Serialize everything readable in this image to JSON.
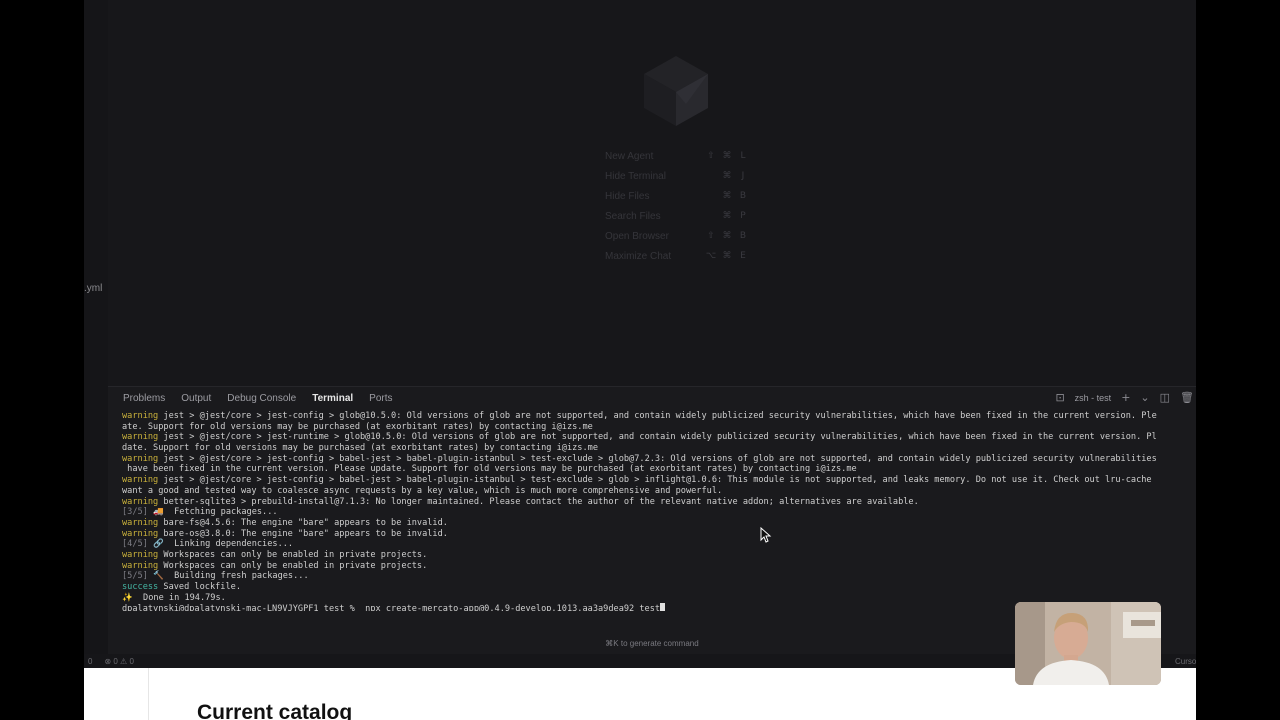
{
  "editor": {
    "file_snippet": ".yml",
    "shortcuts": [
      {
        "label": "New Agent",
        "keys": [
          "⇧",
          "⌘",
          "L"
        ]
      },
      {
        "label": "Hide Terminal",
        "keys": [
          "⌘",
          "J"
        ]
      },
      {
        "label": "Hide Files",
        "keys": [
          "⌘",
          "B"
        ]
      },
      {
        "label": "Search Files",
        "keys": [
          "⌘",
          "P"
        ]
      },
      {
        "label": "Open Browser",
        "keys": [
          "⇧",
          "⌘",
          "B"
        ]
      },
      {
        "label": "Maximize Chat",
        "keys": [
          "⌥",
          "⌘",
          "E"
        ]
      }
    ]
  },
  "panel": {
    "tabs": [
      "Problems",
      "Output",
      "Debug Console",
      "Terminal",
      "Ports"
    ],
    "active_tab": "Terminal",
    "shell_label": "zsh - test",
    "generate_hint": "⌘K to generate command"
  },
  "terminal": {
    "lines": [
      {
        "kw": "warning",
        "text": " jest > @jest/core > jest-config > glob@10.5.0: Old versions of glob are not supported, and contain widely publicized security vulnerabilities, which have been fixed in the current version. Ple"
      },
      {
        "kw": "",
        "text": "ate. Support for old versions may be purchased (at exorbitant rates) by contacting i@izs.me"
      },
      {
        "kw": "warning",
        "text": " jest > @jest/core > jest-runtime > glob@10.5.0: Old versions of glob are not supported, and contain widely publicized security vulnerabilities, which have been fixed in the current version. Pl"
      },
      {
        "kw": "",
        "text": "date. Support for old versions may be purchased (at exorbitant rates) by contacting i@izs.me"
      },
      {
        "kw": "warning",
        "text": " jest > @jest/core > jest-config > babel-jest > babel-plugin-istanbul > test-exclude > glob@7.2.3: Old versions of glob are not supported, and contain widely publicized security vulnerabilities"
      },
      {
        "kw": "",
        "text": " have been fixed in the current version. Please update. Support for old versions may be purchased (at exorbitant rates) by contacting i@izs.me"
      },
      {
        "kw": "warning",
        "text": " jest > @jest/core > jest-config > babel-jest > babel-plugin-istanbul > test-exclude > glob > inflight@1.0.6: This module is not supported, and leaks memory. Do not use it. Check out lru-cache"
      },
      {
        "kw": "",
        "text": "want a good and tested way to coalesce async requests by a key value, which is much more comprehensive and powerful."
      },
      {
        "kw": "warning",
        "text": " better-sqlite3 > prebuild-install@7.1.3: No longer maintained. Please contact the author of the relevant native addon; alternatives are available."
      },
      {
        "kw": "[3/5]",
        "text": " 🚚  Fetching packages..."
      },
      {
        "kw": "warning",
        "text": " bare-fs@4.5.6: The engine \"bare\" appears to be invalid."
      },
      {
        "kw": "warning",
        "text": " bare-os@3.8.0: The engine \"bare\" appears to be invalid."
      },
      {
        "kw": "[4/5]",
        "text": " 🔗  Linking dependencies..."
      },
      {
        "kw": "warning",
        "text": " Workspaces can only be enabled in private projects."
      },
      {
        "kw": "warning",
        "text": " Workspaces can only be enabled in private projects."
      },
      {
        "kw": "[5/5]",
        "text": " 🔨  Building fresh packages..."
      },
      {
        "kw": "success",
        "text": " Saved lockfile."
      },
      {
        "kw": "✨",
        "text": "  Done in 194.79s."
      }
    ],
    "prompt": "dpalatynski@dpalatynski-mac-LN9VJYGPF1 test %  npx create-mercato-app@0.4.9-develop.1013.aa3a9dea92 test"
  },
  "status_bar": {
    "left": "0",
    "problems": "⊗ 0 ⚠ 0",
    "right": "Cursor T"
  },
  "document": {
    "title": "Current catalog"
  }
}
